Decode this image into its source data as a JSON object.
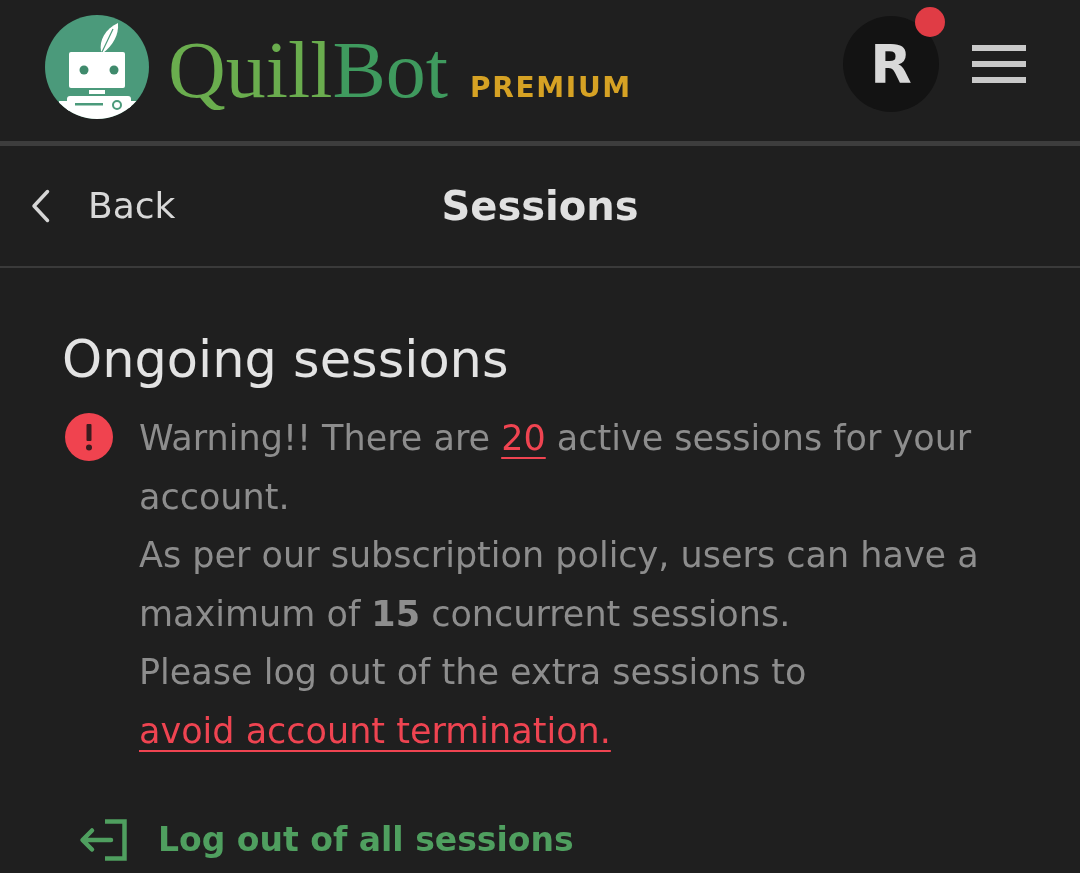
{
  "header": {
    "logo": {
      "wordmark": "QuillBot",
      "tier": "PREMIUM"
    },
    "account": {
      "initial": "R",
      "notification": true
    }
  },
  "nav": {
    "back": "Back",
    "title": "Sessions"
  },
  "section": {
    "heading": "Ongoing sessions",
    "warning": {
      "paragraphs": [
        {
          "segments": [
            {
              "kind": "text",
              "text": "Warning!! There are "
            },
            {
              "kind": "link",
              "text": "20"
            },
            {
              "kind": "text",
              "text": " active sessions for your account."
            }
          ]
        },
        {
          "segments": [
            {
              "kind": "text",
              "text": "As per our subscription policy, users can have a maximum of **15** concurrent sessions."
            }
          ]
        },
        {
          "segments": [
            {
              "kind": "text",
              "text": "Please log out of the extra sessions to "
            },
            {
              "kind": "link",
              "text": "avoid account termination."
            }
          ]
        }
      ]
    }
  },
  "actions": [
    {
      "label": "Log out of all sessions"
    }
  ]
}
